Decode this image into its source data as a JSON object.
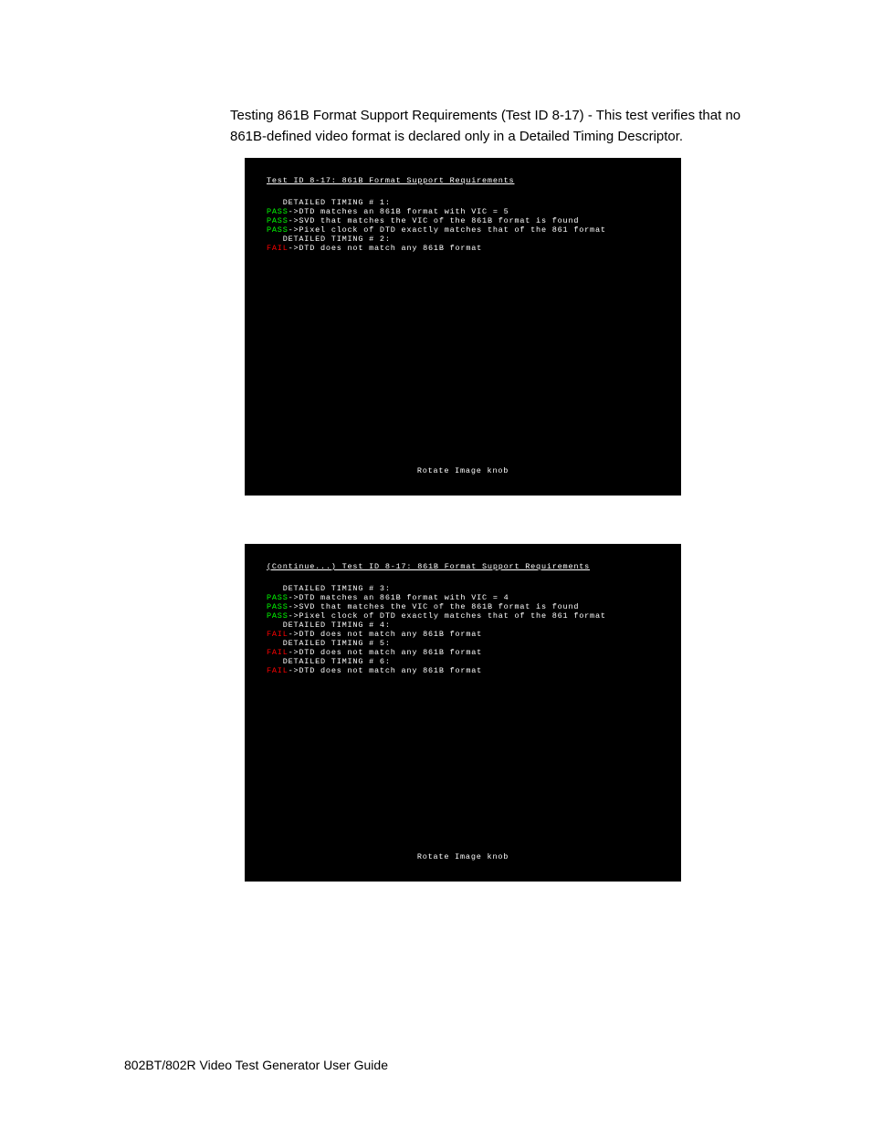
{
  "intro": "Testing 861B Format Support Requirements (Test ID 8-17) - This test verifies that no 861B-defined video format is declared only in a Detailed Timing Descriptor.",
  "footer": "802BT/802R Video Test Generator User Guide",
  "screen1": {
    "title": "Test ID 8-17: 861B Format Support Requirements",
    "lines": [
      {
        "status": "",
        "label": "   DETAILED TIMING # 1:"
      },
      {
        "status": "PASS",
        "label": "->DTD matches an 861B format with VIC = 5"
      },
      {
        "status": "PASS",
        "label": "->SVD that matches the VIC of the 861B format is found"
      },
      {
        "status": "PASS",
        "label": "->Pixel clock of DTD exactly matches that of the 861 format"
      },
      {
        "status": "",
        "label": "   DETAILED TIMING # 2:"
      },
      {
        "status": "FAIL",
        "label": "->DTD does not match any 861B format"
      }
    ],
    "rotate": "Rotate Image knob"
  },
  "screen2": {
    "title": "(Continue...) Test ID 8-17: 861B Format Support Requirements",
    "lines": [
      {
        "status": "",
        "label": "   DETAILED TIMING # 3:"
      },
      {
        "status": "PASS",
        "label": "->DTD matches an 861B format with VIC = 4"
      },
      {
        "status": "PASS",
        "label": "->SVD that matches the VIC of the 861B format is found"
      },
      {
        "status": "PASS",
        "label": "->Pixel clock of DTD exactly matches that of the 861 format"
      },
      {
        "status": "",
        "label": "   DETAILED TIMING # 4:"
      },
      {
        "status": "FAIL",
        "label": "->DTD does not match any 861B format"
      },
      {
        "status": "",
        "label": "   DETAILED TIMING # 5:"
      },
      {
        "status": "FAIL",
        "label": "->DTD does not match any 861B format"
      },
      {
        "status": "",
        "label": "   DETAILED TIMING # 6:"
      },
      {
        "status": "FAIL",
        "label": "->DTD does not match any 861B format"
      }
    ],
    "rotate": "Rotate Image knob"
  }
}
